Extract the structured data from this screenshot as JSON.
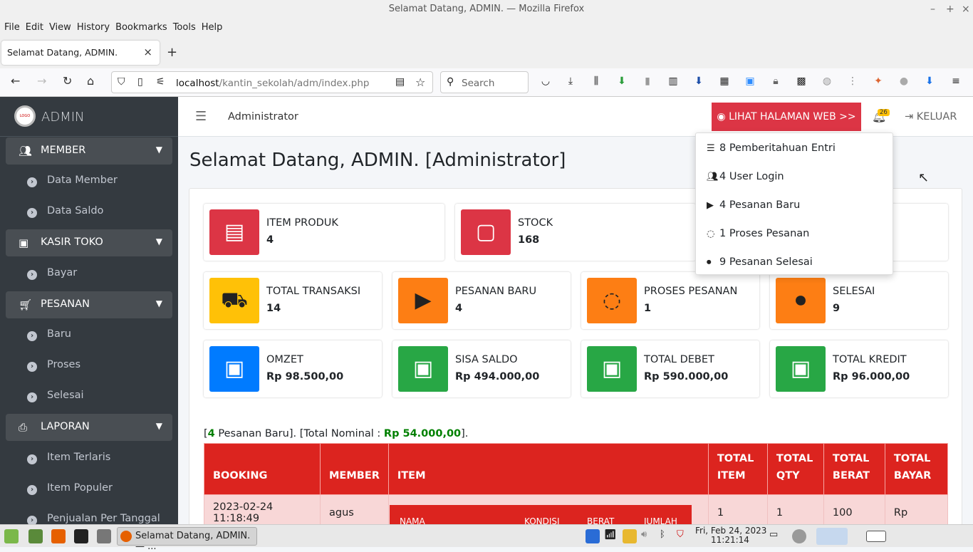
{
  "window": {
    "title": "Selamat Datang, ADMIN. — Mozilla Firefox"
  },
  "menu": [
    "File",
    "Edit",
    "View",
    "History",
    "Bookmarks",
    "Tools",
    "Help"
  ],
  "tab": {
    "title": "Selamat Datang, ADMIN."
  },
  "url": {
    "host": "localhost",
    "path": "/kantin_sekolah/adm/index.php"
  },
  "search": {
    "placeholder": "Search"
  },
  "brand": {
    "logo": "LOGO",
    "name": "ADMIN"
  },
  "sidebar": {
    "groups": [
      {
        "label": "MEMBER",
        "icon": "users-icon",
        "items": [
          "Data Member",
          "Data Saldo"
        ]
      },
      {
        "label": "KASIR TOKO",
        "icon": "money-icon",
        "items": [
          "Bayar"
        ]
      },
      {
        "label": "PESANAN",
        "icon": "cart-icon",
        "items": [
          "Baru",
          "Proses",
          "Selesai"
        ]
      },
      {
        "label": "LAPORAN",
        "icon": "print-icon",
        "items": [
          "Item Terlaris",
          "Item Populer",
          "Penjualan Per Tanggal"
        ]
      }
    ]
  },
  "topnav": {
    "role": "Administrator",
    "web_button": "LIHAT HALAMAN WEB >>",
    "badge": "26",
    "logout": "KELUAR"
  },
  "page": {
    "title": "Selamat Datang, ADMIN. [Administrator]"
  },
  "stats": [
    {
      "label": "ITEM PRODUK",
      "value": "4",
      "color": "#dc3545",
      "icon": "archive-icon"
    },
    {
      "label": "STOCK",
      "value": "168",
      "color": "#dc3545",
      "icon": "briefcase-icon"
    },
    {
      "label": "TOTAL TRANSAKSI",
      "value": "14",
      "color": "#ffc107",
      "icon": "cart-icon"
    },
    {
      "label": "PESANAN BARU",
      "value": "4",
      "color": "#fd7e14",
      "icon": "play-icon"
    },
    {
      "label": "PROSES PESANAN",
      "value": "1",
      "color": "#fd7e14",
      "icon": "spinner-icon"
    },
    {
      "label": "SELESAI",
      "value": "9",
      "color": "#fd7e14",
      "icon": "stop-icon"
    },
    {
      "label": "OMZET",
      "value": "Rp 98.500,00",
      "color": "#007bff",
      "icon": "money-icon"
    },
    {
      "label": "SISA SALDO",
      "value": "Rp 494.000,00",
      "color": "#28a745",
      "icon": "money-icon"
    },
    {
      "label": "TOTAL DEBET",
      "value": "Rp 590.000,00",
      "color": "#28a745",
      "icon": "money-icon"
    },
    {
      "label": "TOTAL KREDIT",
      "value": "Rp 96.000,00",
      "color": "#28a745",
      "icon": "money-icon"
    }
  ],
  "summary": {
    "count": "4",
    "text1": "Pesanan Baru]. [Total Nominal :",
    "amount": "Rp 54.000,00",
    "text2": "]."
  },
  "table": {
    "headers": [
      "BOOKING",
      "MEMBER",
      "ITEM",
      "TOTAL ITEM",
      "TOTAL QTY",
      "TOTAL BERAT",
      "TOTAL BAYAR"
    ],
    "row": {
      "booking": "2023-02-24 11:18:49",
      "member": "agus",
      "total_item": "1",
      "total_qty": "1",
      "total_berat": "100",
      "total_bayar": "Rp"
    },
    "inner_headers": [
      "NAMA",
      "KONDISI",
      "BERAT",
      "JUMLAH"
    ]
  },
  "dropdown": [
    {
      "text": "8 Pemberitahuan Entri",
      "icon": "list-icon"
    },
    {
      "text": "4 User Login",
      "icon": "users-icon"
    },
    {
      "text": "4 Pesanan Baru",
      "icon": "play-icon"
    },
    {
      "text": "1 Proses Pesanan",
      "icon": "spinner-icon"
    },
    {
      "text": "9 Pesanan Selesai",
      "icon": "stop-icon"
    }
  ],
  "taskbar": {
    "window": "Selamat Datang, ADMIN. — ...",
    "date": "Fri, Feb 24, 2023",
    "time": "11:21:14"
  }
}
